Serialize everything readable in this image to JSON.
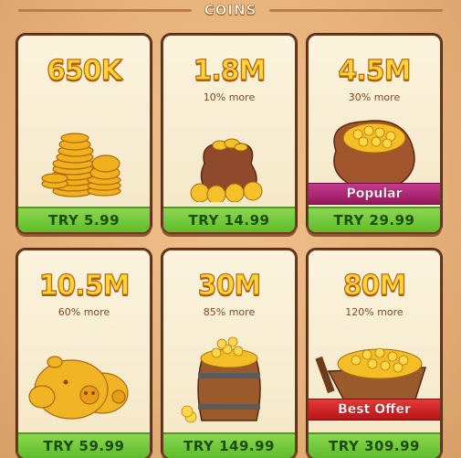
{
  "header": {
    "title": "COINS"
  },
  "offers": [
    {
      "amount": "650K",
      "more": "",
      "price": "TRY 5.99",
      "badge": "",
      "art": "coin-stack"
    },
    {
      "amount": "1.8M",
      "more": "10% more",
      "price": "TRY 14.99",
      "badge": "",
      "art": "coin-pouch"
    },
    {
      "amount": "4.5M",
      "more": "30% more",
      "price": "TRY 29.99",
      "badge": "Popular",
      "art": "coin-sack"
    },
    {
      "amount": "10.5M",
      "more": "60% more",
      "price": "TRY 59.99",
      "badge": "",
      "art": "piggy-banks"
    },
    {
      "amount": "30M",
      "more": "85% more",
      "price": "TRY 149.99",
      "badge": "",
      "art": "coin-barrel"
    },
    {
      "amount": "80M",
      "more": "120% more",
      "price": "TRY 309.99",
      "badge": "Best Offer",
      "art": "coin-cart"
    }
  ],
  "colors": {
    "background": "#e8b57e",
    "card_border": "#6b3a1e",
    "amount_fill": "#ffd43a",
    "price_green": "#6cc436",
    "popular_badge": "#b02a78",
    "best_offer_badge": "#d0262a"
  }
}
